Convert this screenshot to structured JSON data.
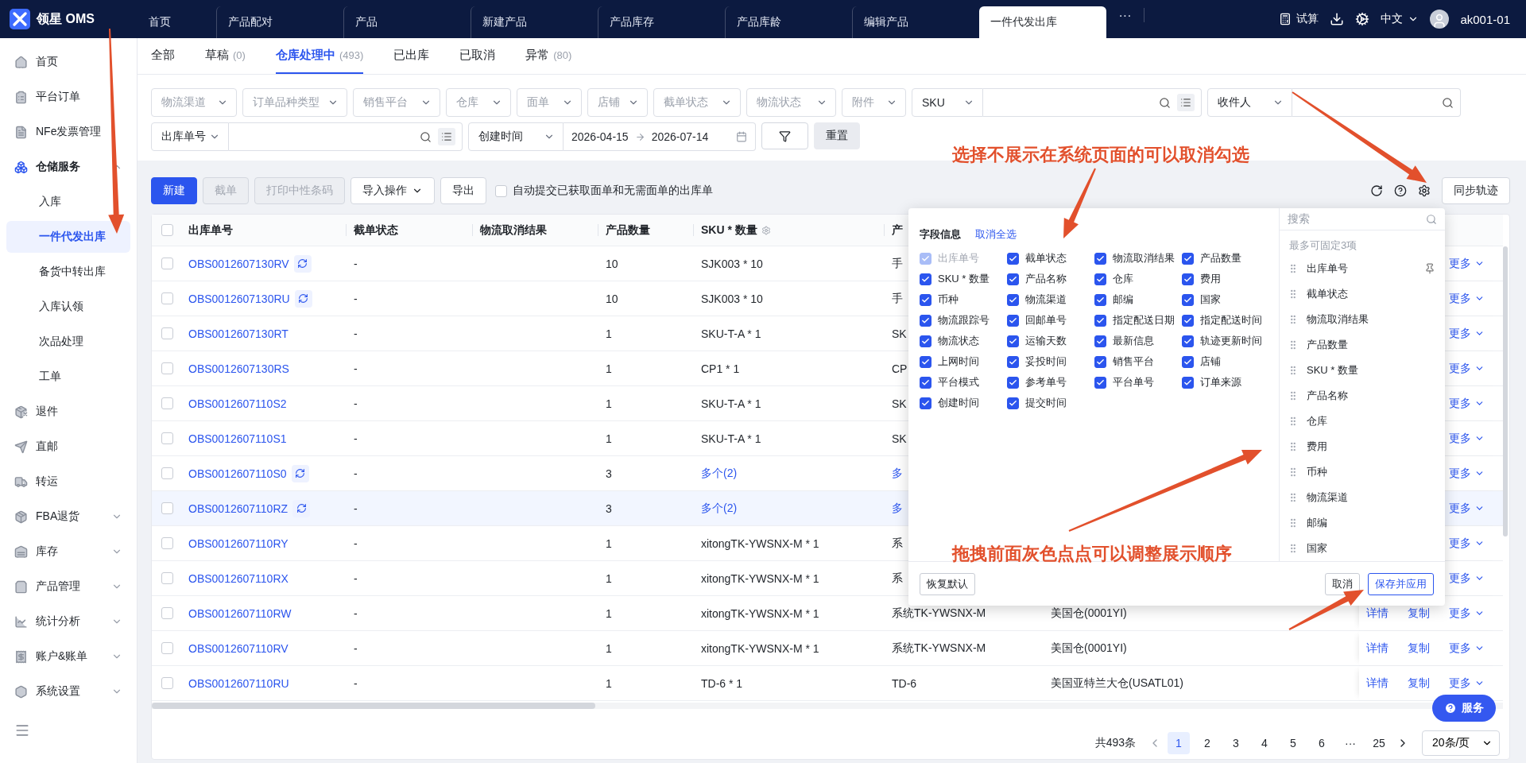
{
  "app": {
    "logo_text": "领星 OMS"
  },
  "top_tabs": [
    {
      "label": "首页",
      "selected": false
    },
    {
      "label": "产品配对",
      "selected": false
    },
    {
      "label": "产品",
      "selected": false
    },
    {
      "label": "新建产品",
      "selected": false
    },
    {
      "label": "产品库存",
      "selected": false
    },
    {
      "label": "产品库龄",
      "selected": false
    },
    {
      "label": "编辑产品",
      "selected": false
    },
    {
      "label": "一件代发出库",
      "selected": true
    }
  ],
  "top_more": "···",
  "top_right": {
    "calc_label": "试算",
    "language": "中文",
    "user": "ak001-01"
  },
  "sidebar": {
    "items": [
      {
        "label": "首页",
        "selected": false
      },
      {
        "label": "平台订单",
        "selected": false
      },
      {
        "label": "NFe发票管理",
        "selected": false
      },
      {
        "label": "仓储服务",
        "selected": true,
        "expanded": true,
        "children": [
          {
            "label": "入库",
            "selected": false
          },
          {
            "label": "一件代发出库",
            "selected": true
          },
          {
            "label": "备货中转出库",
            "selected": false
          },
          {
            "label": "入库认领",
            "selected": false
          },
          {
            "label": "次品处理",
            "selected": false
          },
          {
            "label": "工单",
            "selected": false
          }
        ]
      },
      {
        "label": "退件",
        "selected": false
      },
      {
        "label": "直邮",
        "selected": false
      },
      {
        "label": "转运",
        "selected": false
      },
      {
        "label": "FBA退货",
        "selected": false,
        "expanded": false
      },
      {
        "label": "库存",
        "selected": false,
        "expanded": false
      },
      {
        "label": "产品管理",
        "selected": false,
        "expanded": false
      },
      {
        "label": "统计分析",
        "selected": false,
        "expanded": false
      },
      {
        "label": "账户&账单",
        "selected": false,
        "expanded": false
      },
      {
        "label": "系统设置",
        "selected": false,
        "expanded": false
      }
    ]
  },
  "status_tabs": [
    {
      "label": "全部",
      "selected": false
    },
    {
      "label": "草稿",
      "count": "(0)",
      "selected": false
    },
    {
      "label": "仓库处理中",
      "count": "(493)",
      "selected": true
    },
    {
      "label": "已出库",
      "selected": false
    },
    {
      "label": "已取消",
      "selected": false
    },
    {
      "label": "异常",
      "count": "(80)",
      "selected": false
    }
  ],
  "filters": {
    "row_1": [
      {
        "kind": "select",
        "placeholder": "物流渠道"
      },
      {
        "kind": "select",
        "placeholder": "订单品种类型"
      },
      {
        "kind": "select",
        "placeholder": "销售平台"
      },
      {
        "kind": "select",
        "placeholder": "仓库"
      },
      {
        "kind": "select",
        "placeholder": "面单"
      },
      {
        "kind": "select",
        "placeholder": "店铺"
      },
      {
        "kind": "select",
        "placeholder": "截单状态"
      },
      {
        "kind": "select",
        "placeholder": "物流状态"
      },
      {
        "kind": "select",
        "placeholder": "附件"
      },
      {
        "kind": "search",
        "field": "SKU",
        "batch": true
      },
      {
        "kind": "search",
        "field": "收件人",
        "batch": false
      }
    ],
    "row_2": [
      {
        "kind": "search",
        "field": "出库单号",
        "batch": true
      },
      {
        "kind": "date_range",
        "field": "创建时间",
        "start": "2026-04-15",
        "end": "2026-07-14"
      },
      {
        "kind": "filter_button"
      },
      {
        "kind": "button",
        "label": "重置"
      }
    ]
  },
  "toolbar": {
    "buttons": [
      {
        "label": "新建",
        "kind": "primary",
        "disabled": false,
        "dropdown": false
      },
      {
        "label": "截单",
        "kind": "default",
        "disabled": true,
        "dropdown": false
      },
      {
        "label": "打印中性条码",
        "kind": "default",
        "disabled": true,
        "dropdown": false
      },
      {
        "label": "导入操作",
        "kind": "default",
        "disabled": false,
        "dropdown": true
      },
      {
        "label": "导出",
        "kind": "default",
        "disabled": false,
        "dropdown": false
      }
    ],
    "auto_submit": {
      "label": "自动提交已获取面单和无需面单的出库单",
      "checked": false
    },
    "sync_button": "同步轨迹"
  },
  "table": {
    "header_checked": false,
    "columns": [
      {
        "label": "出库单号",
        "hint": false
      },
      {
        "label": "截单状态",
        "hint": false
      },
      {
        "label": "物流取消结果",
        "hint": false
      },
      {
        "label": "产品数量",
        "hint": false
      },
      {
        "label": "SKU * 数量",
        "hint": true
      },
      {
        "label": "产",
        "hint": false
      }
    ],
    "rows": [
      {
        "order_no": "OBS0012607130RV",
        "refresh": true,
        "checked": false,
        "highlighted": false,
        "cutoff": "-",
        "qty": "10",
        "sku": "SJK003 * 10",
        "sku_link": false,
        "product": "手",
        "product_link": false,
        "actions": [
          {
            "label": "更多",
            "menu": true
          }
        ]
      },
      {
        "order_no": "OBS0012607130RU",
        "refresh": true,
        "checked": false,
        "highlighted": false,
        "cutoff": "-",
        "qty": "10",
        "sku": "SJK003 * 10",
        "sku_link": false,
        "product": "手",
        "product_link": false,
        "actions": [
          {
            "label": "更多",
            "menu": true
          }
        ]
      },
      {
        "order_no": "OBS0012607130RT",
        "refresh": false,
        "checked": false,
        "highlighted": false,
        "cutoff": "-",
        "qty": "1",
        "sku": "SKU-T-A * 1",
        "sku_link": false,
        "product": "SK",
        "product_link": false,
        "actions": [
          {
            "label": "更多",
            "menu": true
          }
        ]
      },
      {
        "order_no": "OBS0012607130RS",
        "refresh": false,
        "checked": false,
        "highlighted": false,
        "cutoff": "-",
        "qty": "1",
        "sku": "CP1 * 1",
        "sku_link": false,
        "product": "CP",
        "product_link": false,
        "actions": [
          {
            "label": "更多",
            "menu": true
          }
        ]
      },
      {
        "order_no": "OBS0012607110S2",
        "refresh": false,
        "checked": false,
        "highlighted": false,
        "cutoff": "-",
        "qty": "1",
        "sku": "SKU-T-A * 1",
        "sku_link": false,
        "product": "SK",
        "product_link": false,
        "actions": [
          {
            "label": "更多",
            "menu": true
          }
        ]
      },
      {
        "order_no": "OBS0012607110S1",
        "refresh": false,
        "checked": false,
        "highlighted": false,
        "cutoff": "-",
        "qty": "1",
        "sku": "SKU-T-A * 1",
        "sku_link": false,
        "product": "SK",
        "product_link": false,
        "actions": [
          {
            "label": "更多",
            "menu": true
          }
        ]
      },
      {
        "order_no": "OBS0012607110S0",
        "refresh": true,
        "checked": false,
        "highlighted": false,
        "cutoff": "-",
        "qty": "3",
        "sku": "多个(2)",
        "sku_link": true,
        "product": "多",
        "product_link": true,
        "actions": [
          {
            "label": "更多",
            "menu": true
          }
        ]
      },
      {
        "order_no": "OBS0012607110RZ",
        "refresh": true,
        "checked": false,
        "highlighted": true,
        "cutoff": "-",
        "qty": "3",
        "sku": "多个(2)",
        "sku_link": true,
        "product": "多",
        "product_link": true,
        "actions": [
          {
            "label": "更多",
            "menu": true
          }
        ]
      },
      {
        "order_no": "OBS0012607110RY",
        "refresh": false,
        "checked": false,
        "highlighted": false,
        "cutoff": "-",
        "qty": "1",
        "sku": "xitongTK-YWSNX-M * 1",
        "sku_link": false,
        "product": "系",
        "product_link": false,
        "actions": [
          {
            "label": "更多",
            "menu": true
          }
        ]
      },
      {
        "order_no": "OBS0012607110RX",
        "refresh": false,
        "checked": false,
        "highlighted": false,
        "cutoff": "-",
        "qty": "1",
        "sku": "xitongTK-YWSNX-M * 1",
        "sku_link": false,
        "product": "系",
        "product_link": false,
        "actions": [
          {
            "label": "更多",
            "menu": true
          }
        ]
      },
      {
        "order_no": "OBS0012607110RW",
        "refresh": false,
        "checked": false,
        "highlighted": false,
        "cutoff": "-",
        "qty": "1",
        "sku": "xitongTK-YWSNX-M * 1",
        "sku_link": false,
        "product": "系统TK-YWSNX-M",
        "product_link": false,
        "warehouse": "美国仓(0001YI)",
        "actions": [
          {
            "label": "详情",
            "menu": false
          },
          {
            "label": "复制",
            "menu": false
          },
          {
            "label": "更多",
            "menu": true
          }
        ]
      },
      {
        "order_no": "OBS0012607110RV",
        "refresh": false,
        "checked": false,
        "highlighted": false,
        "cutoff": "-",
        "qty": "1",
        "sku": "xitongTK-YWSNX-M * 1",
        "sku_link": false,
        "product": "系统TK-YWSNX-M",
        "product_link": false,
        "warehouse": "美国仓(0001YI)",
        "actions": [
          {
            "label": "详情",
            "menu": false
          },
          {
            "label": "复制",
            "menu": false
          },
          {
            "label": "更多",
            "menu": true
          }
        ]
      },
      {
        "order_no": "OBS0012607110RU",
        "refresh": false,
        "checked": false,
        "highlighted": false,
        "cutoff": "-",
        "qty": "1",
        "sku": "TD-6 * 1",
        "sku_link": false,
        "product": "TD-6",
        "product_link": false,
        "warehouse": "美国亚特兰大仓(USATL01)",
        "actions": [
          {
            "label": "详情",
            "menu": false
          },
          {
            "label": "复制",
            "menu": false
          },
          {
            "label": "更多",
            "menu": true
          }
        ]
      }
    ]
  },
  "pagination": {
    "total": "共493条",
    "pages": [
      {
        "label": "1",
        "selected": true
      },
      {
        "label": "2",
        "selected": false
      },
      {
        "label": "3",
        "selected": false
      },
      {
        "label": "4",
        "selected": false
      },
      {
        "label": "5",
        "selected": false
      },
      {
        "label": "6",
        "selected": false
      },
      {
        "label": "···",
        "selected": false
      },
      {
        "label": "25",
        "selected": false
      }
    ],
    "page_size": "20条/页"
  },
  "column_settings": {
    "title": "字段信息",
    "clear_all": "取消全选",
    "fields": [
      {
        "label": "出库单号",
        "checked": true,
        "disabled": true
      },
      {
        "label": "截单状态",
        "checked": true,
        "disabled": false
      },
      {
        "label": "物流取消结果",
        "checked": true,
        "disabled": false
      },
      {
        "label": "产品数量",
        "checked": true,
        "disabled": false
      },
      {
        "label": "SKU * 数量",
        "checked": true,
        "disabled": false
      },
      {
        "label": "产品名称",
        "checked": true,
        "disabled": false
      },
      {
        "label": "仓库",
        "checked": true,
        "disabled": false
      },
      {
        "label": "费用",
        "checked": true,
        "disabled": false
      },
      {
        "label": "币种",
        "checked": true,
        "disabled": false
      },
      {
        "label": "物流渠道",
        "checked": true,
        "disabled": false
      },
      {
        "label": "邮编",
        "checked": true,
        "disabled": false
      },
      {
        "label": "国家",
        "checked": true,
        "disabled": false
      },
      {
        "label": "物流跟踪号",
        "checked": true,
        "disabled": false
      },
      {
        "label": "回邮单号",
        "checked": true,
        "disabled": false
      },
      {
        "label": "指定配送日期",
        "checked": true,
        "disabled": false
      },
      {
        "label": "指定配送时间",
        "checked": true,
        "disabled": false
      },
      {
        "label": "物流状态",
        "checked": true,
        "disabled": false
      },
      {
        "label": "运输天数",
        "checked": true,
        "disabled": false
      },
      {
        "label": "最新信息",
        "checked": true,
        "disabled": false
      },
      {
        "label": "轨迹更新时间",
        "checked": true,
        "disabled": false
      },
      {
        "label": "上网时间",
        "checked": true,
        "disabled": false
      },
      {
        "label": "妥投时间",
        "checked": true,
        "disabled": false
      },
      {
        "label": "销售平台",
        "checked": true,
        "disabled": false
      },
      {
        "label": "店铺",
        "checked": true,
        "disabled": false
      },
      {
        "label": "平台模式",
        "checked": true,
        "disabled": false
      },
      {
        "label": "参考单号",
        "checked": true,
        "disabled": false
      },
      {
        "label": "平台单号",
        "checked": true,
        "disabled": false
      },
      {
        "label": "订单来源",
        "checked": true,
        "disabled": false
      },
      {
        "label": "创建时间",
        "checked": true,
        "disabled": false
      },
      {
        "label": "提交时间",
        "checked": true,
        "disabled": false
      }
    ],
    "search_placeholder": "搜索",
    "pin_hint": "最多可固定3项",
    "order": [
      {
        "label": "出库单号",
        "pinned": true
      },
      {
        "label": "截单状态",
        "pinned": false
      },
      {
        "label": "物流取消结果",
        "pinned": false
      },
      {
        "label": "产品数量",
        "pinned": false
      },
      {
        "label": "SKU * 数量",
        "pinned": false
      },
      {
        "label": "产品名称",
        "pinned": false
      },
      {
        "label": "仓库",
        "pinned": false
      },
      {
        "label": "费用",
        "pinned": false
      },
      {
        "label": "币种",
        "pinned": false
      },
      {
        "label": "物流渠道",
        "pinned": false
      },
      {
        "label": "邮编",
        "pinned": false
      },
      {
        "label": "国家",
        "pinned": false
      }
    ],
    "reset": "恢复默认",
    "cancel": "取消",
    "save": "保存并应用"
  },
  "help_button": {
    "label": "服务"
  },
  "annotations": [
    {
      "text": "选择不展示在系统页面的可以取消勾选"
    },
    {
      "text": "拖拽前面灰色点点可以调整展示顺序"
    }
  ]
}
